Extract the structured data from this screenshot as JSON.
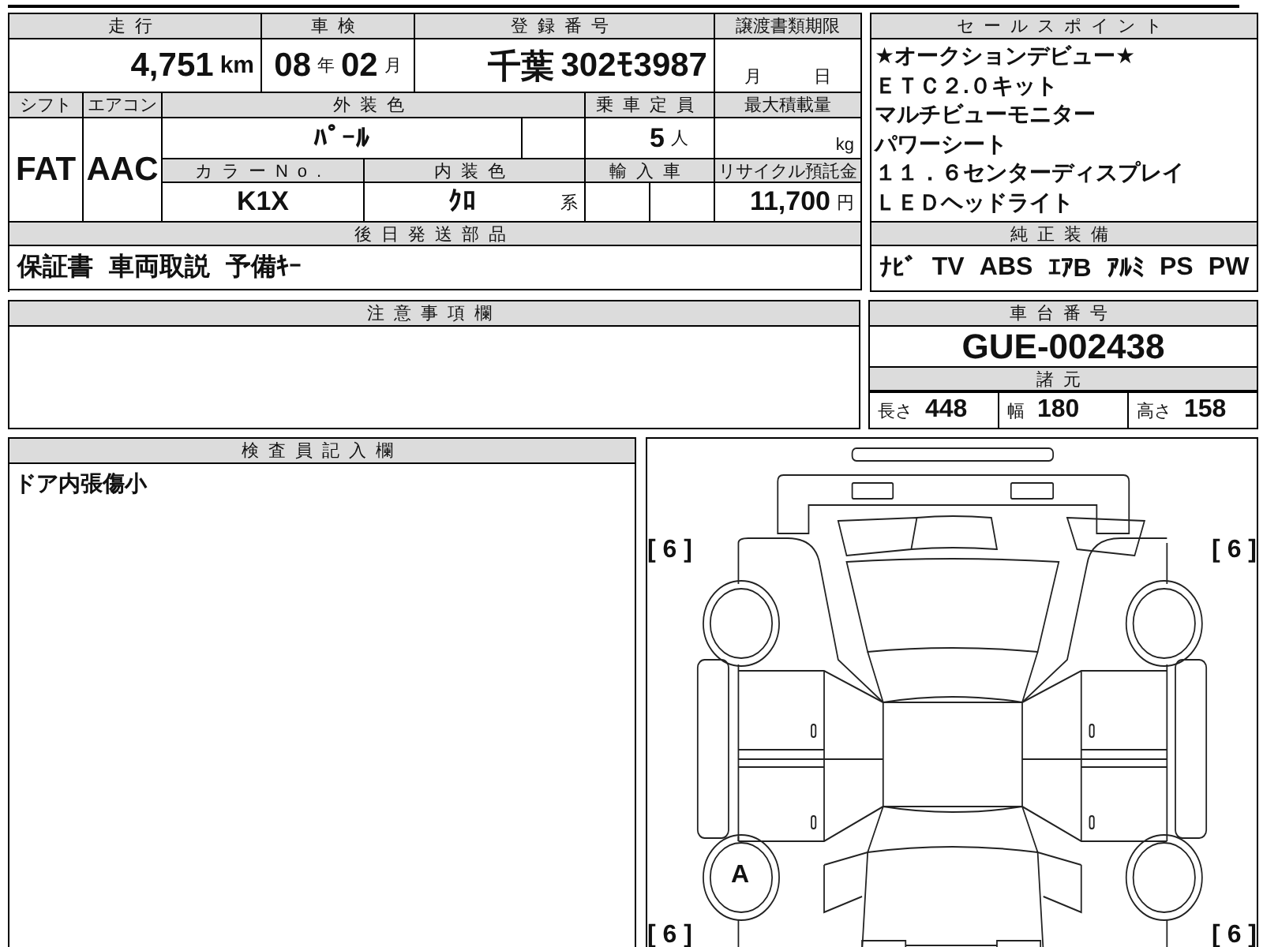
{
  "mileage": {
    "label": "走行",
    "value": "4,751",
    "unit": "km"
  },
  "inspection": {
    "label": "車検",
    "year": "08",
    "year_unit": "年",
    "month": "02",
    "month_unit": "月"
  },
  "registration": {
    "label": "登録番号",
    "area": "千葉",
    "number": "302ﾓ3987"
  },
  "transfer_deadline": {
    "label": "譲渡書類期限",
    "month_unit": "月",
    "day_unit": "日"
  },
  "shift": {
    "label": "シフト",
    "value": "FAT"
  },
  "aircon": {
    "label": "エアコン",
    "value": "AAC"
  },
  "exterior_color": {
    "label": "外装色",
    "value": "ﾊﾟｰﾙ"
  },
  "capacity": {
    "label": "乗車定員",
    "value": "5",
    "unit": "人"
  },
  "max_load": {
    "label": "最大積載量",
    "unit": "kg"
  },
  "color_no": {
    "label": "カラーNo.",
    "value": "K1X"
  },
  "interior_color": {
    "label": "内装色",
    "value": "ｸﾛ",
    "suffix": "系"
  },
  "imported": {
    "label": "輸入車"
  },
  "recycle_fee": {
    "label": "リサイクル預託金",
    "value": "11,700",
    "unit": "円"
  },
  "later_parts": {
    "label": "後日発送部品",
    "items": [
      "保証書",
      "車両取説",
      "予備ｷｰ"
    ]
  },
  "notes": {
    "label": "注意事項欄"
  },
  "sales_points": {
    "label": "セールスポイント",
    "lines": [
      "★オークションデビュー★",
      "ＥＴＣ２.０キット",
      "マルチビューモニター",
      "パワーシート",
      "１１．６センターディスプレイ",
      "ＬＥＤヘッドライト"
    ]
  },
  "equipment": {
    "label": "純正装備",
    "items": [
      "ﾅﾋﾞ",
      "TV",
      "ABS",
      "ｴｱB",
      "ｱﾙﾐ",
      "PS",
      "PW"
    ]
  },
  "chassis": {
    "label": "車台番号",
    "value": "GUE-002438"
  },
  "specs": {
    "label": "諸元",
    "items": [
      {
        "label": "長さ",
        "value": "448"
      },
      {
        "label": "幅",
        "value": "180"
      },
      {
        "label": "高さ",
        "value": "158"
      }
    ]
  },
  "inspector": {
    "label": "検査員記入欄",
    "note": "ドア内張傷小"
  },
  "diagram": {
    "tires": [
      {
        "label": "[ 6 ]"
      },
      {
        "label": "[ 6 ]"
      },
      {
        "label": "[ 6 ]",
        "mark": "A"
      },
      {
        "label": "[ 6 ]"
      }
    ]
  }
}
